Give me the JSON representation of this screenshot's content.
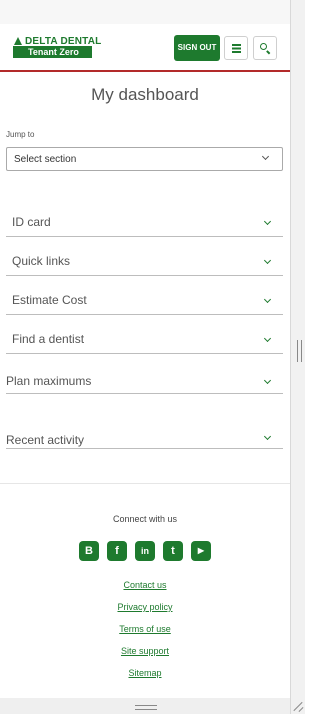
{
  "header": {
    "logo_name": "DELTA DENTAL",
    "logo_tenant": "Tenant Zero",
    "signout_label": "SIGN OUT",
    "menu_icon": "hamburger-menu-icon",
    "search_icon": "search-icon",
    "brand_color": "#1e7a2e",
    "accent_line_color": "#b32a2a"
  },
  "main": {
    "title": "My dashboard",
    "jump_label": "Jump to",
    "jump_select_value": "Select section",
    "sections": [
      {
        "label": "ID card"
      },
      {
        "label": "Quick links"
      },
      {
        "label": "Estimate Cost"
      },
      {
        "label": "Find a dentist"
      },
      {
        "label": "Plan maximums"
      },
      {
        "label": "Recent activity"
      }
    ]
  },
  "footer": {
    "connect": "Connect with us",
    "socials": [
      {
        "icon": "blogger-icon",
        "glyph": "B"
      },
      {
        "icon": "facebook-icon",
        "glyph": "f"
      },
      {
        "icon": "linkedin-icon",
        "glyph": "in"
      },
      {
        "icon": "twitter-icon",
        "glyph": "t"
      },
      {
        "icon": "youtube-icon",
        "glyph": "▶"
      }
    ],
    "links": [
      "Contact us",
      "Privacy policy",
      "Terms of use",
      "Site support",
      "Sitemap"
    ]
  }
}
